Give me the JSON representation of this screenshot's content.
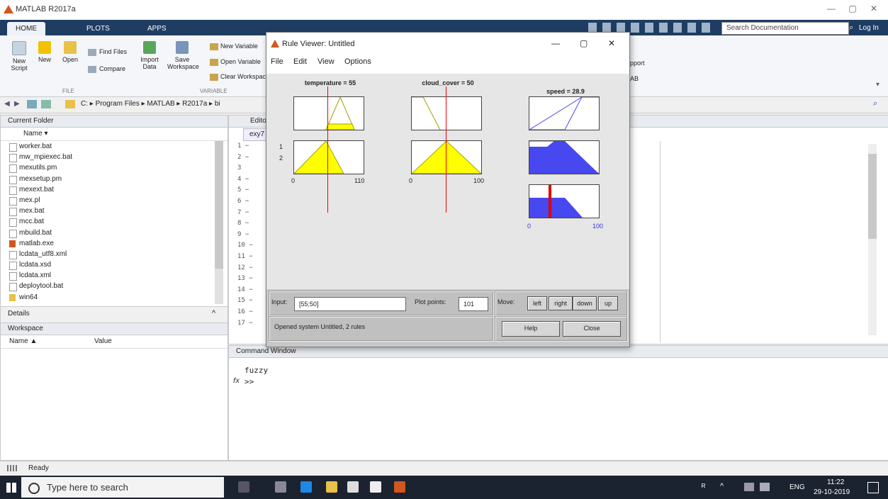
{
  "app": {
    "title": "MATLAB R2017a"
  },
  "tabs": [
    {
      "label": "HOME"
    },
    {
      "label": "PLOTS"
    },
    {
      "label": "APPS"
    }
  ],
  "search": {
    "placeholder": "Search Documentation"
  },
  "login": "Log In",
  "ribbon": {
    "new_script": "New\nScript",
    "new": "New",
    "open": "Open",
    "find_files": "Find Files",
    "compare": "Compare",
    "import_data": "Import\nData",
    "save_workspace": "Save\nWorkspace",
    "new_variable": "New Variable",
    "open_variable": "Open Variable",
    "clear_workspace": "Clear Workspace",
    "support": "Support",
    "lab": "LAB",
    "group_file": "FILE",
    "group_variable": "VARIABLE"
  },
  "address": {
    "path": "C:  ▸  Program Files  ▸  MATLAB  ▸  R2017a  ▸  bi"
  },
  "current_folder": {
    "title": "Current Folder",
    "col_name": "Name ▾",
    "files": [
      "worker.bat",
      "mw_mpiexec.bat",
      "mexutils.pm",
      "mexsetup.pm",
      "mexext.bat",
      "mex.pl",
      "mex.bat",
      "mcc.bat",
      "mbuild.bat",
      "matlab.exe",
      "lcdata_utf8.xml",
      "lcdata.xsd",
      "lcdata.xml",
      "deploytool.bat",
      "win64"
    ]
  },
  "details": {
    "title": "Details"
  },
  "workspace": {
    "title": "Workspace",
    "col_name": "Name ▲",
    "col_value": "Value"
  },
  "editor": {
    "title": "Editor",
    "tab": "exy7",
    "line_numbers": [
      "1  −",
      "2  −",
      "3",
      "4  −",
      "5  −",
      "6  −",
      "7  −",
      "8  −",
      "9  −",
      "10  −",
      "11  −",
      "12  −",
      "13  −",
      "14  −",
      "15  −",
      "16  −",
      "17  −"
    ]
  },
  "command_window": {
    "title": "Command Window",
    "line1": "fuzzy",
    "prompt": ">>",
    "fx": "fx"
  },
  "status": {
    "text": "Ready"
  },
  "taskbar": {
    "search_placeholder": "Type here to search",
    "lang": "ENG",
    "time": "11:22",
    "date": "29-10-2019"
  },
  "rule_viewer": {
    "title": "Rule Viewer: Untitled",
    "menu": [
      "File",
      "Edit",
      "View",
      "Options"
    ],
    "inputs": [
      {
        "label": "temperature = 55",
        "range": [
          "0",
          "110"
        ]
      },
      {
        "label": "cloud_cover = 50",
        "range": [
          "0",
          "100"
        ]
      }
    ],
    "output": {
      "label": "speed = 28.9",
      "range": [
        "0",
        "100"
      ]
    },
    "rules": [
      "1",
      "2"
    ],
    "input_label": "Input:",
    "input_value": "[55;50]",
    "plot_points_label": "Plot points:",
    "plot_points_value": "101",
    "move_label": "Move:",
    "move_buttons": [
      "left",
      "right",
      "down",
      "up"
    ],
    "status": "Opened system Untitled, 2 rules",
    "help": "Help",
    "close": "Close"
  },
  "colors": {
    "ribbon_dark": "#1f3d63",
    "mf_yellow": "#ffff00",
    "mf_blue": "#4848f0",
    "crisp_red": "#e00000"
  }
}
